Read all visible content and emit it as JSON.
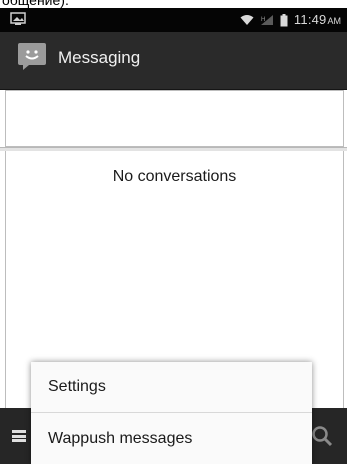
{
  "caption": "общение).",
  "status_bar": {
    "time": "11:49",
    "ampm": "AM",
    "icons": [
      "screenshot-notification-icon",
      "wifi-icon",
      "signal-icon",
      "battery-icon"
    ]
  },
  "action_bar": {
    "title": "Messaging",
    "icon": "messaging-app-icon"
  },
  "conversation_list": {
    "empty_message": "No conversations"
  },
  "menu_popup": {
    "items": [
      {
        "label": "Settings"
      },
      {
        "label": "Wappush messages"
      }
    ]
  },
  "bottom_bar": {
    "icons": [
      "menu-icon",
      "search-icon"
    ]
  },
  "colors": {
    "status_bar": "#050505",
    "action_bar": "#2a2a2a",
    "bottom_bar": "#262626",
    "popup": "#fafafa"
  }
}
